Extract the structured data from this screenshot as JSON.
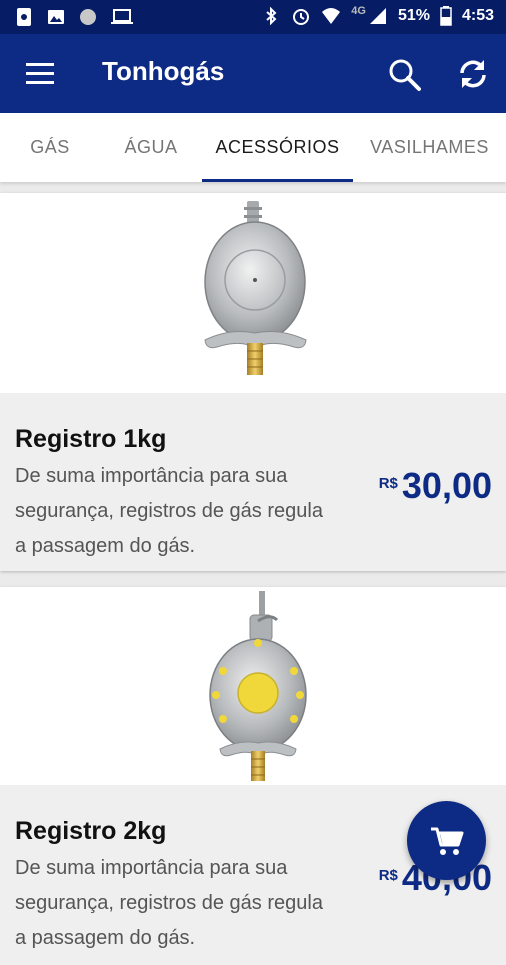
{
  "status_bar": {
    "network": "4G",
    "battery": "51%",
    "time": "4:53"
  },
  "app_bar": {
    "title": "Tonhogás",
    "menu_icon": "menu-icon",
    "search_icon": "search-icon",
    "refresh_icon": "refresh-icon"
  },
  "tabs": [
    {
      "label": "GÁS",
      "active": false
    },
    {
      "label": "ÁGUA",
      "active": false
    },
    {
      "label": "ACESSÓRIOS",
      "active": true
    },
    {
      "label": "VASILHAMES",
      "active": false
    }
  ],
  "products": [
    {
      "name": "Registro 1kg",
      "description": "De suma importância para sua segurança, registros de gás regula a passagem do gás.",
      "currency": "R$",
      "price": "30,00",
      "image_icon": "gas-regulator-image"
    },
    {
      "name": "Registro 2kg",
      "description": "De suma importância para sua segurança, registros de gás regula a passagem do gás.",
      "currency": "R$",
      "price": "40,00",
      "image_icon": "gas-regulator-yellow-image"
    }
  ],
  "fab": {
    "icon": "cart-icon"
  },
  "colors": {
    "primary": "#0d2a85",
    "status_bar": "#061d66",
    "card_info_bg": "#efefef",
    "accent_yellow": "#f1d83a"
  }
}
